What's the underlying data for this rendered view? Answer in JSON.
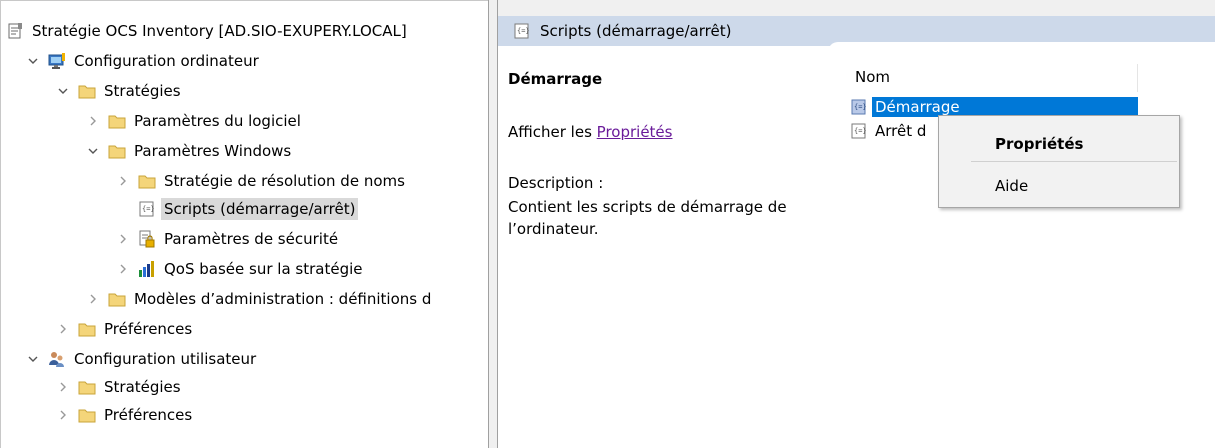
{
  "tree": {
    "root": "Stratégie OCS Inventory [AD.SIO-EXUPERY.LOCAL]",
    "computer_config": "Configuration ordinateur",
    "cc_strategies": "Stratégies",
    "cc_software_settings": "Paramètres du logiciel",
    "cc_windows_settings": "Paramètres Windows",
    "ws_name_resolution": "Stratégie de résolution de noms",
    "ws_scripts": "Scripts (démarrage/arrêt)",
    "ws_security": "Paramètres de sécurité",
    "ws_qos": "QoS basée sur la stratégie",
    "cc_admin_templates": "Modèles d’administration : définitions d",
    "cc_preferences": "Préférences",
    "user_config": "Configuration utilisateur",
    "uc_strategies": "Stratégies",
    "uc_preferences": "Préférences"
  },
  "header": {
    "title": "Scripts (démarrage/arrêt)"
  },
  "extended": {
    "title": "Démarrage",
    "link_prefix": "Afficher les ",
    "link_text": "Propriétés ",
    "desc_label": "Description :",
    "desc_text": "Contient les scripts de démarrage de l’ordinateur."
  },
  "list": {
    "column_name": "Nom",
    "items": [
      {
        "label": "Démarrage"
      },
      {
        "label": "Arrêt d"
      }
    ]
  },
  "context_menu": {
    "items": [
      {
        "label": "Propriétés"
      },
      {
        "label": "Aide"
      }
    ]
  },
  "colors": {
    "selection": "#0078d7",
    "header_band": "#cdd9ea",
    "link": "#6a1b9a"
  }
}
